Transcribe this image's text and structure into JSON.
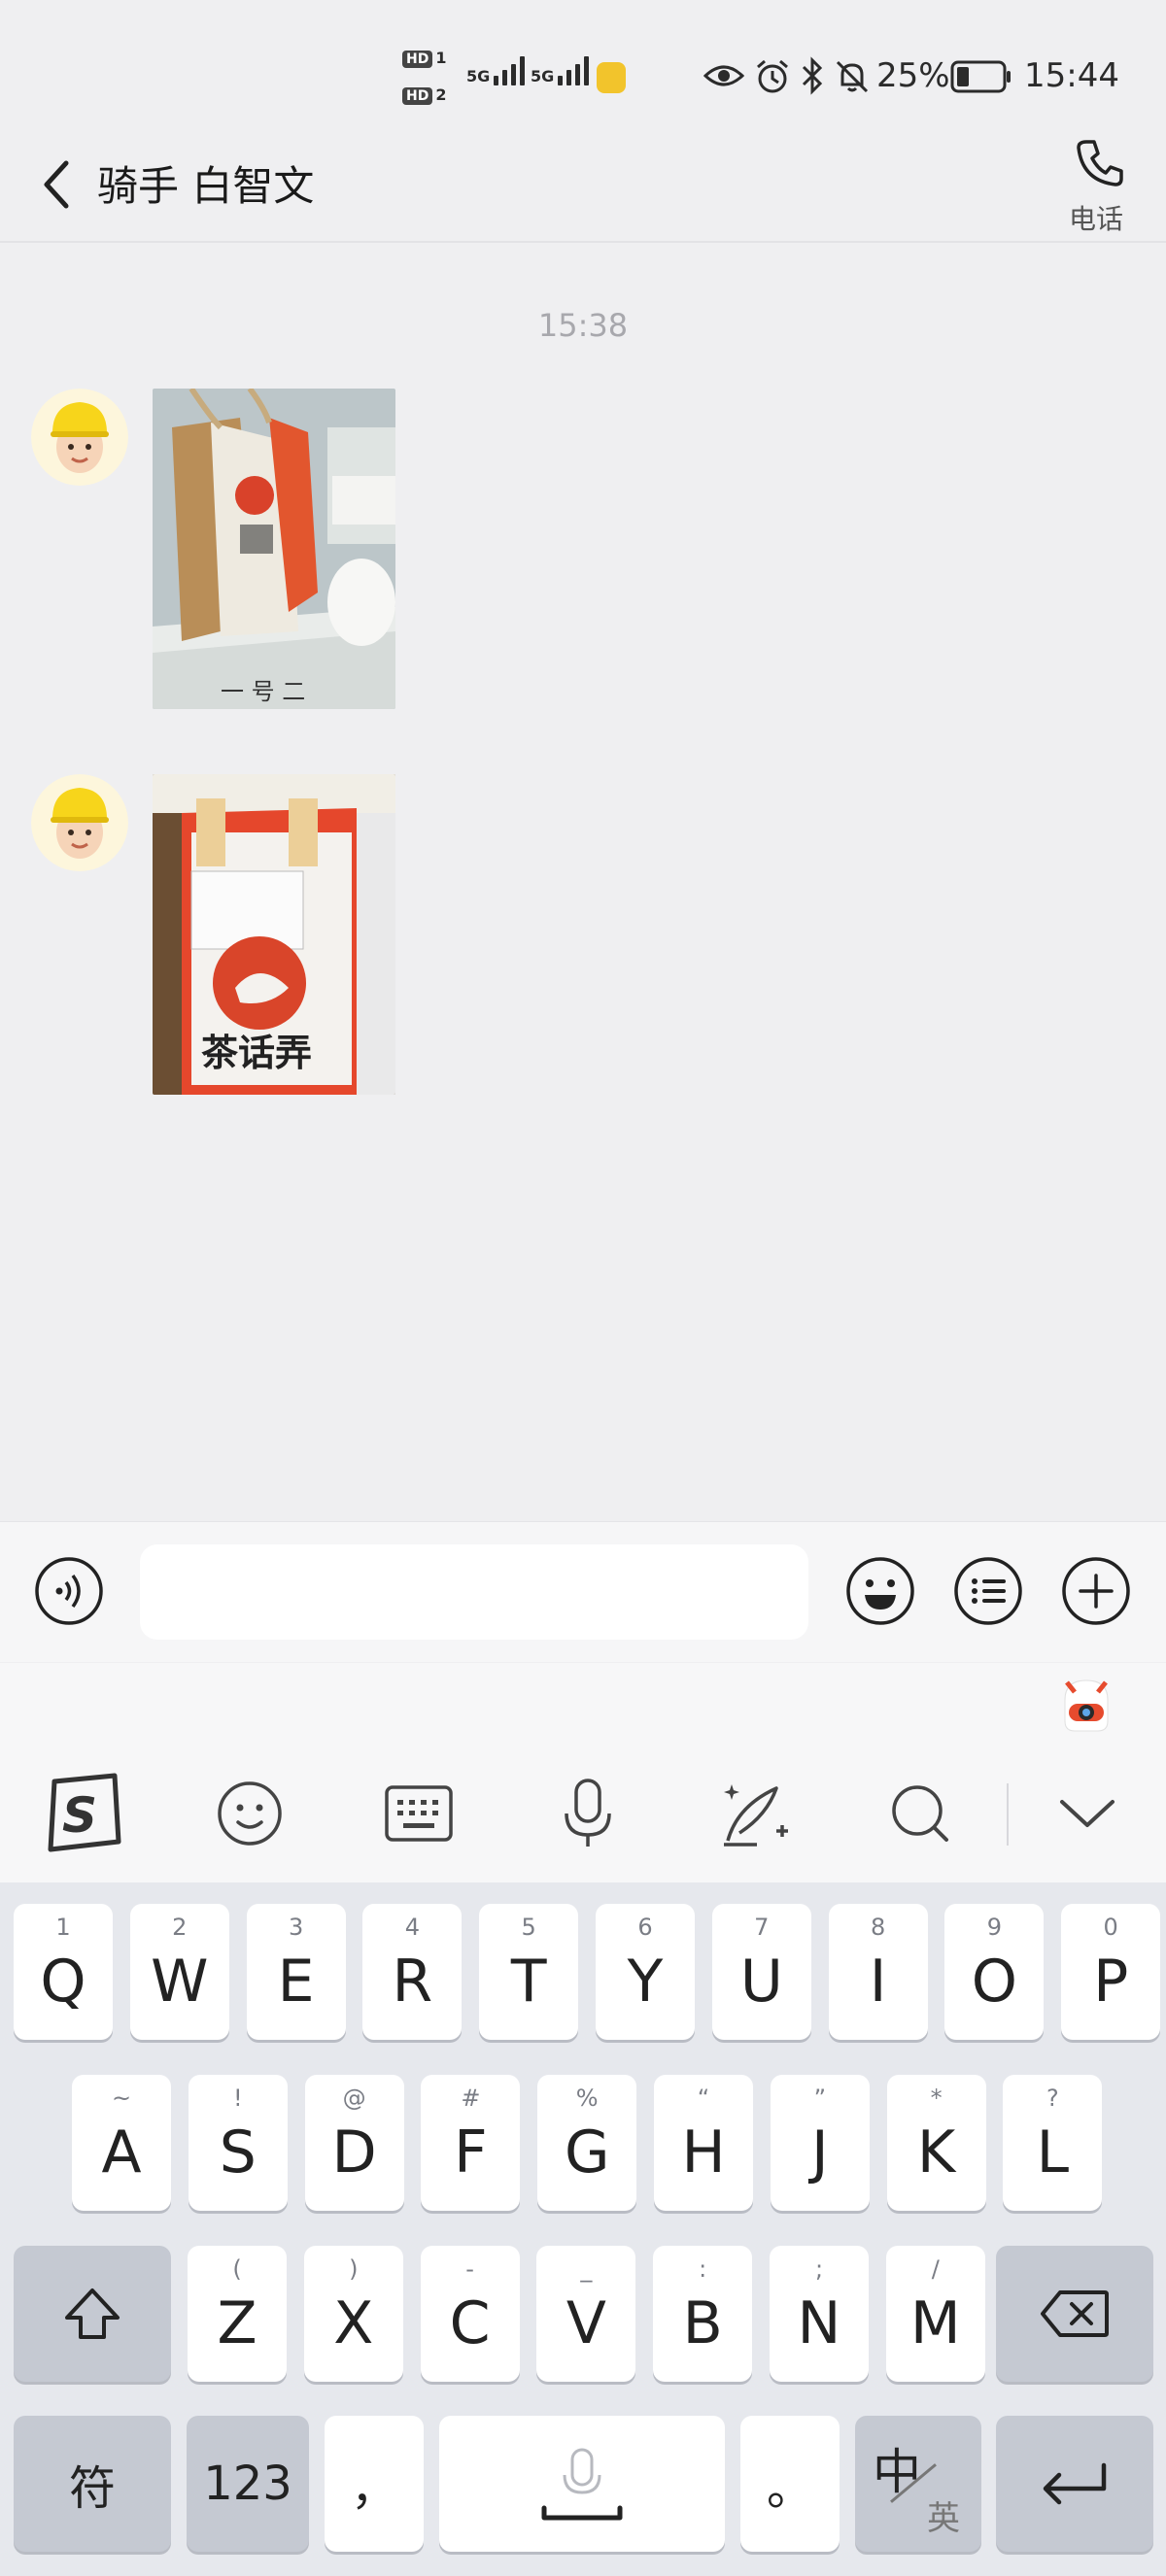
{
  "status_bar": {
    "hd1": "HD",
    "hd1_num": "1",
    "hd2": "HD",
    "hd2_num": "2",
    "sig1": "5G",
    "sig2": "5G",
    "battery": "25%",
    "time": "15:44"
  },
  "header": {
    "title": "骑手 白智文",
    "call_label": "电话"
  },
  "chat": {
    "timestamp": "15:38"
  },
  "input": {
    "value": "",
    "placeholder": ""
  },
  "keyboard": {
    "row1": [
      {
        "main": "Q",
        "sub": "1"
      },
      {
        "main": "W",
        "sub": "2"
      },
      {
        "main": "E",
        "sub": "3"
      },
      {
        "main": "R",
        "sub": "4"
      },
      {
        "main": "T",
        "sub": "5"
      },
      {
        "main": "Y",
        "sub": "6"
      },
      {
        "main": "U",
        "sub": "7"
      },
      {
        "main": "I",
        "sub": "8"
      },
      {
        "main": "O",
        "sub": "9"
      },
      {
        "main": "P",
        "sub": "0"
      }
    ],
    "row2": [
      {
        "main": "A",
        "sub": "~"
      },
      {
        "main": "S",
        "sub": "!"
      },
      {
        "main": "D",
        "sub": "@"
      },
      {
        "main": "F",
        "sub": "#"
      },
      {
        "main": "G",
        "sub": "%"
      },
      {
        "main": "H",
        "sub": "“"
      },
      {
        "main": "J",
        "sub": "”"
      },
      {
        "main": "K",
        "sub": "*"
      },
      {
        "main": "L",
        "sub": "?"
      }
    ],
    "row3": [
      {
        "main": "Z",
        "sub": "("
      },
      {
        "main": "X",
        "sub": ")"
      },
      {
        "main": "C",
        "sub": "-"
      },
      {
        "main": "V",
        "sub": "_"
      },
      {
        "main": "B",
        "sub": ":"
      },
      {
        "main": "N",
        "sub": ";"
      },
      {
        "main": "M",
        "sub": "/"
      }
    ],
    "symbol_key": "符",
    "number_key": "123",
    "comma_key": "，",
    "period_key": "。",
    "lang_main": "中",
    "lang_sub": "英"
  },
  "colors": {
    "background": "#efeff1",
    "keyboard_bg": "#e6e8ed",
    "key_dark": "#c5c9d2"
  }
}
